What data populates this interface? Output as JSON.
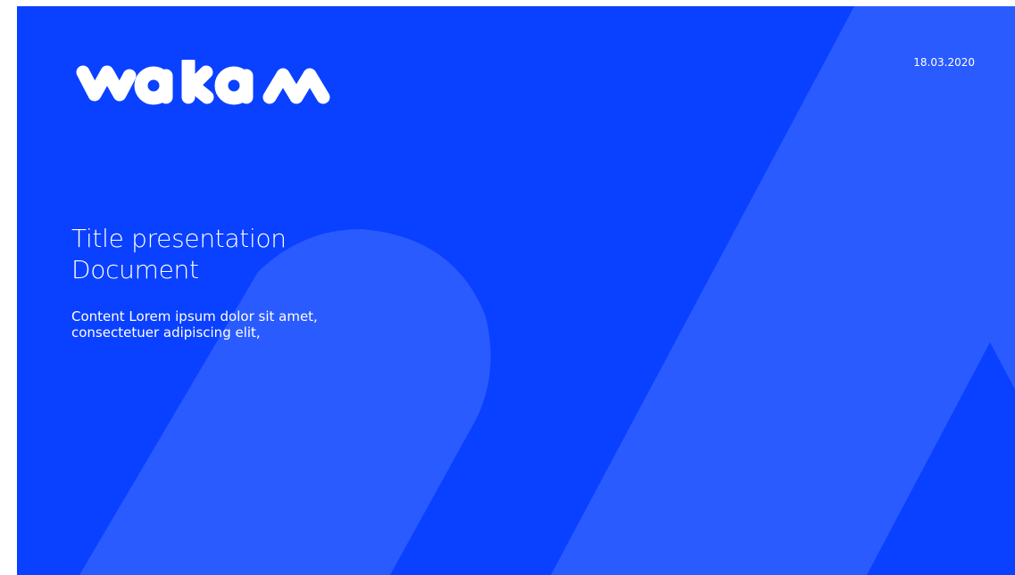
{
  "slide": {
    "brand": "wakam",
    "date": "18.03.2020",
    "title_lines": [
      "Title presentation",
      "Document"
    ],
    "content_lines": [
      "Content Lorem ipsum dolor sit amet,",
      "consectetuer adipiscing elit,"
    ],
    "colors": {
      "background": "#0a40ff",
      "shape": "#2a5bff",
      "text": "#ffffff"
    }
  }
}
